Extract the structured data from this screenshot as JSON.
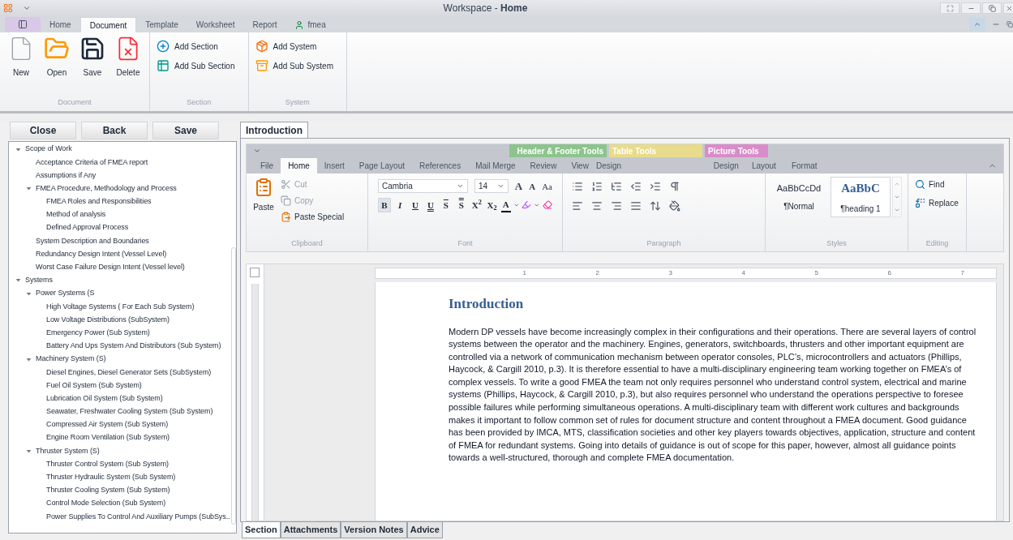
{
  "window": {
    "title": "Workspace - **Home**"
  },
  "main_tabs": [
    {
      "label": "Home",
      "selected": false
    },
    {
      "label": "Document",
      "selected": true
    },
    {
      "label": "Template",
      "selected": false
    },
    {
      "label": "Worksheet",
      "selected": false
    },
    {
      "label": "Report",
      "selected": false
    },
    {
      "label": "fmea",
      "selected": false,
      "kind": "user"
    }
  ],
  "ribbon_groups": [
    {
      "label": "Document",
      "buttons": [
        {
          "label": "New",
          "kind": "new"
        },
        {
          "label": "Open",
          "kind": "open"
        },
        {
          "label": "Save",
          "kind": "save"
        },
        {
          "label": "Delete",
          "kind": "delete"
        }
      ]
    },
    {
      "label": "Section",
      "buttons": [
        {
          "label": "Add Section",
          "kind": "add-section"
        },
        {
          "label": "Add Sub Section",
          "kind": "add-sub-section"
        }
      ]
    },
    {
      "label": "System",
      "buttons": [
        {
          "label": "Add System",
          "kind": "add-system"
        },
        {
          "label": "Add Sub System",
          "kind": "add-sub-system"
        }
      ]
    }
  ],
  "panel_buttons": [
    "Close",
    "Back",
    "Save"
  ],
  "tree": [
    {
      "label": "Scope of Work",
      "expanded": true,
      "children": [
        {
          "label": "Acceptance Criteria of FMEA report"
        },
        {
          "label": "Assumptions if Any"
        },
        {
          "label": "FMEA Procedure, Methodology and Process",
          "expanded": true,
          "children": [
            {
              "label": "FMEA Roles and Responsibilities"
            },
            {
              "label": "Method of analysis"
            },
            {
              "label": "Defined Approval Process"
            }
          ]
        },
        {
          "label": "System Description and Boundaries"
        },
        {
          "label": "Redundancy Design Intent (Vessel Level)"
        },
        {
          "label": "Worst Case Failure Design Intent (Vessel level)"
        }
      ]
    },
    {
      "label": "Systems",
      "expanded": true,
      "children": [
        {
          "label": "Power Systems (S",
          "expanded": true,
          "children": [
            {
              "label": "High Voltage Systems ( For Each Sub System)"
            },
            {
              "label": "Low Voltage Distributions (SubSystem)"
            },
            {
              "label": "Emergency Power (Sub System)"
            },
            {
              "label": "Battery And Ups System And Distributors (Sub System)"
            }
          ]
        },
        {
          "label": "Machinery System (S)",
          "expanded": true,
          "children": [
            {
              "label": "Diesel Engines, Diesel Generator Sets (SubSystem)"
            },
            {
              "label": "Fuel Oil System (Sub System)"
            },
            {
              "label": "Lubrication Oil System (Sub System)"
            },
            {
              "label": "Seawater, Freshwater Cooling System (Sub System)"
            },
            {
              "label": "Compressed Air System (Sub System)"
            },
            {
              "label": "Engine Room Ventilation (Sub System)"
            }
          ]
        },
        {
          "label": "Thruster System (S)",
          "expanded": true,
          "children": [
            {
              "label": "Thruster Control System (Sub System)"
            },
            {
              "label": "Thruster Hydraulic System (Sub System)"
            },
            {
              "label": "Thruster Cooling System (Sub System)"
            },
            {
              "label": "Control Mode Selection (Sub System)"
            },
            {
              "label": "Power Supplies To Control And Auxiliary Pumps (SubSys.."
            }
          ]
        }
      ]
    }
  ],
  "doc_tabs": [
    {
      "label": "Introduction",
      "selected": true
    }
  ],
  "editor": {
    "tabs": [
      {
        "label": "File",
        "selected": false
      },
      {
        "label": "Home",
        "selected": true
      },
      {
        "label": "Insert",
        "selected": false
      },
      {
        "label": "Page Layout",
        "selected": false
      },
      {
        "label": "References",
        "selected": false
      },
      {
        "label": "Mail Merge",
        "selected": false
      },
      {
        "label": "Review",
        "selected": false
      },
      {
        "label": "View",
        "selected": false
      }
    ],
    "context_groups": [
      {
        "title": "Header & Footer Tools",
        "color": "#8cc48c",
        "tabs": [
          "Design"
        ]
      },
      {
        "title": "Table Tools",
        "color": "#e8dc8c",
        "tabs": [
          "Design",
          "Layout"
        ]
      },
      {
        "title": "Picture Tools",
        "color": "#d88cc8",
        "tabs": [
          "Format"
        ]
      }
    ],
    "clipboard": {
      "label": "Clipboard",
      "paste": "Paste",
      "items": [
        {
          "label": "Cut",
          "kind": "cut",
          "disabled": true
        },
        {
          "label": "Copy",
          "kind": "copy",
          "disabled": true
        },
        {
          "label": "Paste Special",
          "kind": "paste-special",
          "disabled": false
        }
      ]
    },
    "font": {
      "label": "Font",
      "name": "Cambria",
      "size": "14",
      "grow": "A",
      "shrink": "A",
      "case": "Aa",
      "format_buttons": [
        {
          "label": "B",
          "kind": "bold",
          "selected": true
        },
        {
          "label": "I",
          "kind": "italic",
          "selected": false
        },
        {
          "label": "U",
          "kind": "underline",
          "selected": false
        },
        {
          "label": "U",
          "kind": "double-underline",
          "selected": false
        },
        {
          "label": "S",
          "kind": "strike",
          "selected": false
        },
        {
          "label": "S",
          "kind": "double-strike",
          "selected": false
        },
        {
          "label": "X$^{2}$",
          "kind": "plain",
          "selected": false
        },
        {
          "label": "X$_{2}$",
          "kind": "plain",
          "selected": false
        }
      ],
      "color_label": "A"
    },
    "paragraph": {
      "label": "Paragraph"
    },
    "styles": {
      "label": "Styles",
      "items": [
        {
          "preview": "AaBbCcDd",
          "name": "¶Normal",
          "kind": "normal",
          "selected": false
        },
        {
          "preview": "AaBbC",
          "name": "¶heading 1",
          "kind": "heading",
          "selected": true
        }
      ]
    },
    "editing": {
      "label": "Editing",
      "items": [
        {
          "label": "Find",
          "kind": "find"
        },
        {
          "label": "Replace",
          "kind": "replace"
        }
      ]
    },
    "ruler": [
      "1",
      "2",
      "3",
      "4",
      "5",
      "6",
      "7"
    ],
    "heading": "Introduction",
    "body": "Modern DP vessels have become increasingly complex in their configurations and their operations. There are several layers of control systems between the operator and the machinery. Engines, generators, switchboards, thrusters and other important equipment are controlled via a network of communication mechanism between operator consoles, PLC’s, microcontrollers and actuators (Phillips, Haycock, & Cargill 2010, p.3). It is therefore essential to have a multi-disciplinary engineering team working together on FMEA’s of complex vessels. To write a good FMEA the team not only requires personnel who understand control system, electrical and marine systems (Phillips, Haycock, & Cargill 2010, p.3), but also requires personnel who understand the operations perspective to foresee possible failures while performing simultaneous operations. A multi-disciplinary team with different work cultures and backgrounds makes it important to follow common set of rules for document structure and content throughout a FMEA document. Good guidance has been provided by IMCA, MTS, classification societies and other key players towards objectives, application, structure and content of FMEA for redundant systems. Going into details of guidance is out of scope for this paper, however, almost all guidance points towards a well-structured, thorough and complete FMEA documentation."
  },
  "bottom_tabs": [
    {
      "label": "Section",
      "selected": true
    },
    {
      "label": "Attachments",
      "selected": false
    },
    {
      "label": "Version Notes",
      "selected": false
    },
    {
      "label": "Advice",
      "selected": false
    }
  ]
}
